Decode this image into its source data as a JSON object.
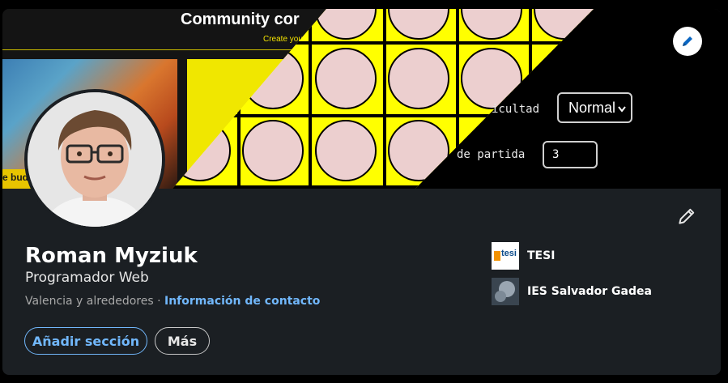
{
  "banner": {
    "collage_title": "Community cor",
    "collage_subtitle": "Create you",
    "thumb_text": "e bud",
    "dificultad_label": "icultad",
    "dificultad_value": "Normal",
    "partida_label": "de partida",
    "partida_value": "3"
  },
  "profile": {
    "name": "Roman Myziuk",
    "headline": "Programador Web",
    "location": "Valencia y alrededores",
    "separator": " · ",
    "contact_link": "Información de contacto"
  },
  "actions": {
    "add_section": "Añadir sección",
    "more": "Más"
  },
  "organizations": [
    {
      "name": "TESI",
      "logo_text": "tesi"
    },
    {
      "name": "IES Salvador Gadea"
    }
  ],
  "icons": {
    "edit_banner": "pencil-icon",
    "edit_intro": "pencil-icon",
    "select_caret": "chevron-down-icon"
  },
  "colors": {
    "card_bg": "#1b1f23",
    "link": "#71b7fb",
    "board": "#ffff00",
    "token": "#eccfcf"
  }
}
